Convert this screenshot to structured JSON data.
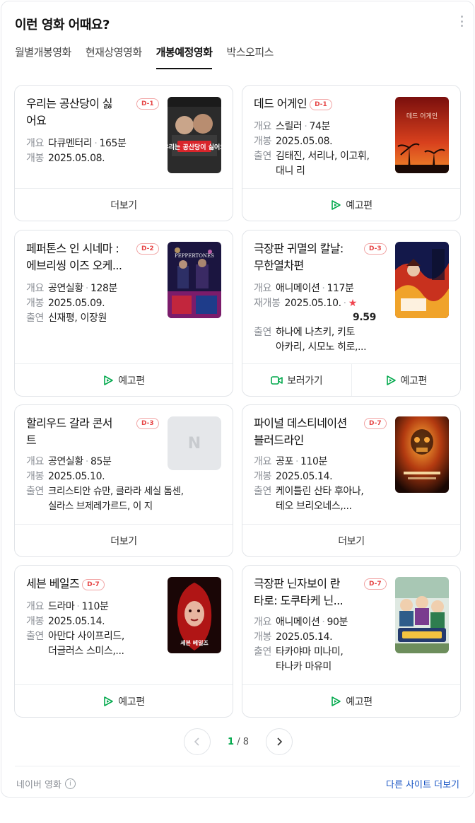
{
  "header": {
    "title": "이런 영화 어때요?"
  },
  "tabs": [
    {
      "label": "월별개봉영화"
    },
    {
      "label": "현재상영영화"
    },
    {
      "label": "개봉예정영화"
    },
    {
      "label": "박스오피스"
    }
  ],
  "cards": [
    {
      "title_l1": "우리는 공산당이 싫",
      "title_l2": "어요",
      "dday": "D-1",
      "genre": "다큐멘터리",
      "runtime": "165분",
      "release": "2025.05.08.",
      "button": "더보기",
      "poster_caption": "우리는 공산당이 싫어요"
    },
    {
      "title_l1": "데드 어게인",
      "dday": "D-1",
      "genre": "스릴러",
      "runtime": "74분",
      "release": "2025.05.08.",
      "cast_l1": "김태진, 서리나, 이고휘,",
      "cast_l2": "대니 리",
      "button": "예고편",
      "poster_caption": "데드 어게인"
    },
    {
      "title_l1": "페퍼톤스 인 시네마 :",
      "title_l2": "에브리씽 이즈 오케...",
      "dday": "D-2",
      "genre": "공연실황",
      "runtime": "128분",
      "release": "2025.05.09.",
      "cast_l1": "신재평, 이장원",
      "button": "예고편",
      "poster_caption": "PEPPERTONES"
    },
    {
      "title_l1": "극장판 귀멸의 칼날:",
      "title_l2": "무한열차편",
      "dday": "D-3",
      "genre": "애니메이션",
      "runtime": "117분",
      "release": "2025.05.10.",
      "rating": "9.59",
      "cast_l1": "하나에 나츠키, 키토",
      "cast_l2": "아카리, 시모노 히로,...",
      "button_watch": "보러가기",
      "button": "예고편"
    },
    {
      "title_l1": "할리우드 갈라 콘서",
      "title_l2": "트",
      "dday": "D-3",
      "genre": "공연실황",
      "runtime": "85분",
      "release": "2025.05.10.",
      "cast_l1": "크리스티안 슈만, 클라라 세실 톰센,",
      "cast_l2": "실라스 브제레가르드, 이 지",
      "button": "더보기",
      "poster_placeholder": "N"
    },
    {
      "title_l1": "파이널 데스티네이션",
      "title_l2": "블러드라인",
      "dday": "D-7",
      "genre": "공포",
      "runtime": "110분",
      "release": "2025.05.14.",
      "cast_l1": "케이틀린 산타 후아나,",
      "cast_l2": "테오 브리오네스,...",
      "button": "더보기"
    },
    {
      "title_l1": "세븐 베일즈",
      "dday": "D-7",
      "genre": "드라마",
      "runtime": "110분",
      "release": "2025.05.14.",
      "cast_l1": "아만다 사이프리드,",
      "cast_l2": "더글러스 스미스,...",
      "button": "예고편",
      "poster_caption": "세븐 베일즈"
    },
    {
      "title_l1": "극장판 닌자보이 란",
      "title_l2": "타로: 도쿠타케 닌...",
      "dday": "D-7",
      "genre": "애니메이션",
      "runtime": "90분",
      "release": "2025.05.14.",
      "cast_l1": "타카야마 미나미,",
      "cast_l2": "타나카 마유미",
      "button": "예고편"
    }
  ],
  "labels": {
    "overview": "개요",
    "release": "개봉",
    "rerelease": "재개봉",
    "cast": "출연",
    "star": "★"
  },
  "pagination": {
    "current": "1",
    "separator": "/",
    "total": "8"
  },
  "footer": {
    "source": "네이버 영화",
    "info_icon": "i",
    "more_link": "다른 사이트 더보기"
  },
  "colors": {
    "accent_green": "#03a94d",
    "dday_red": "#e64545",
    "link_blue": "#1a56c4",
    "star_red": "#f0454f"
  }
}
